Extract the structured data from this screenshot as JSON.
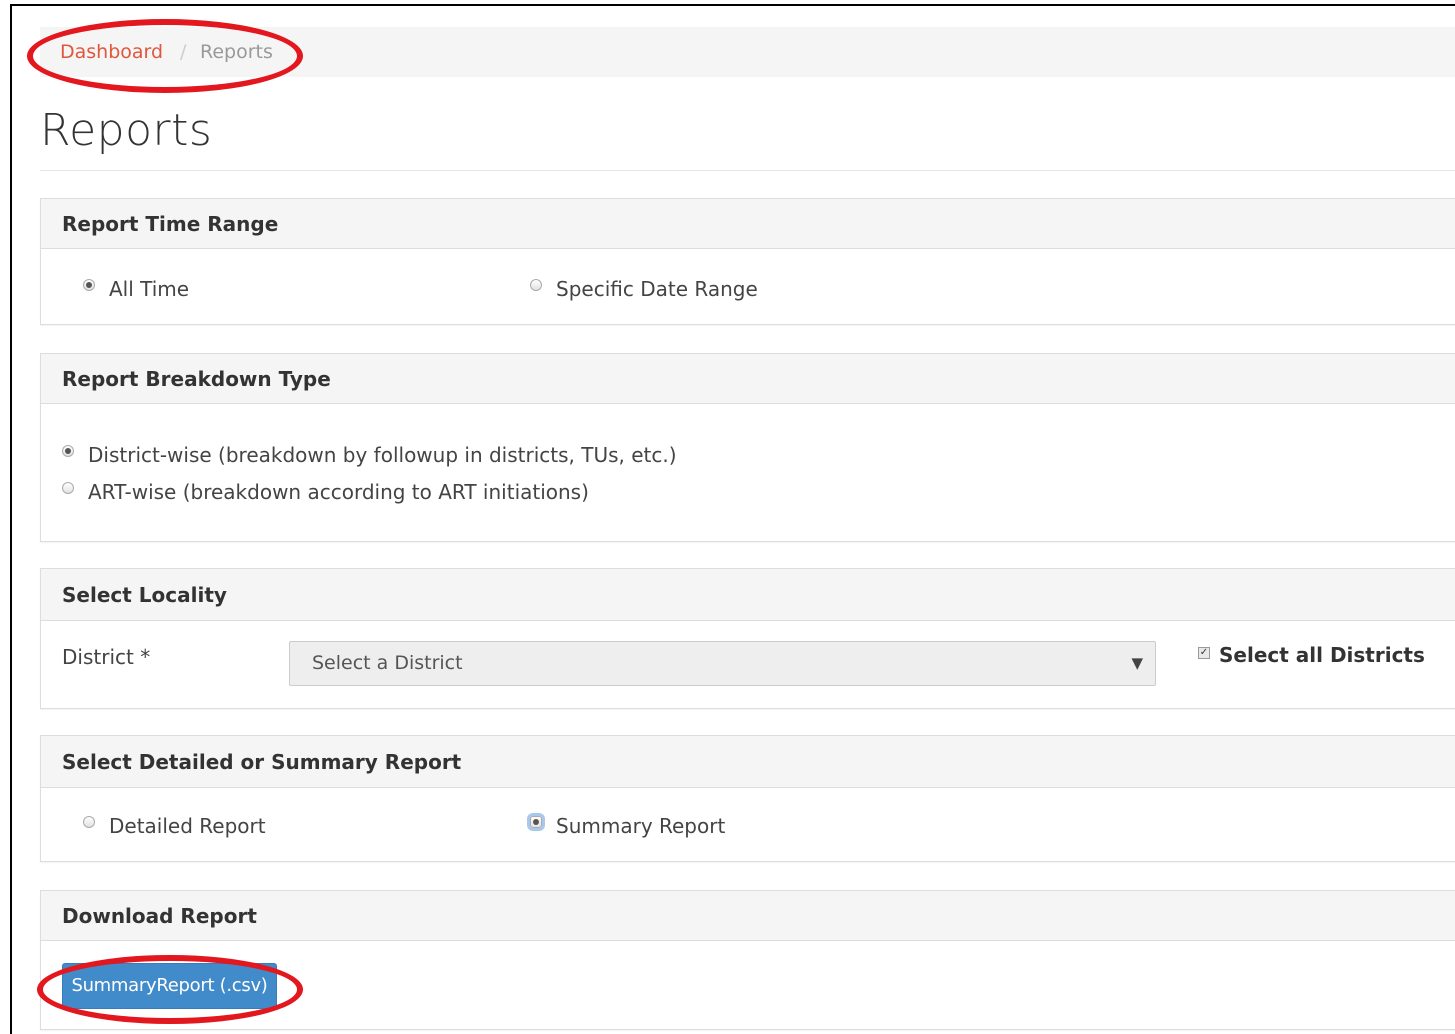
{
  "breadcrumb": {
    "link": "Dashboard",
    "separator": "/",
    "current": "Reports"
  },
  "page_title": "Reports",
  "time_range": {
    "heading": "Report Time Range",
    "options": [
      {
        "label": "All Time",
        "checked": true
      },
      {
        "label": "Specific Date Range",
        "checked": false
      }
    ]
  },
  "breakdown": {
    "heading": "Report Breakdown Type",
    "options": [
      {
        "label": "District-wise (breakdown by followup in districts, TUs, etc.)",
        "checked": true
      },
      {
        "label": "ART-wise (breakdown according to ART initiations)",
        "checked": false
      }
    ]
  },
  "locality": {
    "heading": "Select Locality",
    "district_label": "District *",
    "district_placeholder": "Select a District",
    "caret": "▼",
    "select_all_label": "Select all Districts",
    "select_all_checked": true,
    "check_mark": "✓"
  },
  "report_type": {
    "heading": "Select Detailed or Summary Report",
    "options": [
      {
        "label": "Detailed Report",
        "checked": false
      },
      {
        "label": "Summary Report",
        "checked": true
      }
    ]
  },
  "download": {
    "heading": "Download Report",
    "button_label": "SummaryReport (.csv)"
  },
  "colors": {
    "link": "#e0573d",
    "button": "#428bca",
    "annotation": "#e3171e"
  }
}
